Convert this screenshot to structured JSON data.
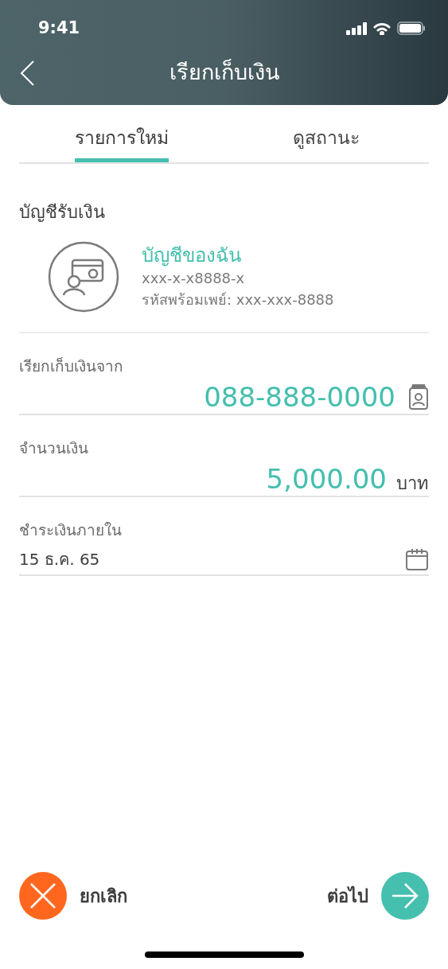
{
  "status_bar": {
    "time": "9:41"
  },
  "header": {
    "title": "เรียกเก็บเงิน"
  },
  "tabs": [
    {
      "label": "รายการใหม่",
      "selected": true
    },
    {
      "label": "ดูสถานะ",
      "selected": false
    }
  ],
  "account_section": {
    "title": "บัญชีรับเงิน",
    "name": "บัญชีของฉัน",
    "number": "xxx-x-x8888-x",
    "promptpay": "รหัสพร้อมเพย์: xxx-xxx-8888"
  },
  "fields": [
    {
      "kind": "phone",
      "label": "เรียกเก็บเงินจาก",
      "value": "088-888-0000"
    },
    {
      "kind": "amount",
      "label": "จำนวนเงิน",
      "value": "5,000.00",
      "unit": "บาท"
    },
    {
      "kind": "date",
      "label": "ชำระเงินภายใน",
      "value": "15 ธ.ค. 65"
    }
  ],
  "actions": {
    "cancel": "ยกเลิก",
    "next": "ต่อไป"
  }
}
